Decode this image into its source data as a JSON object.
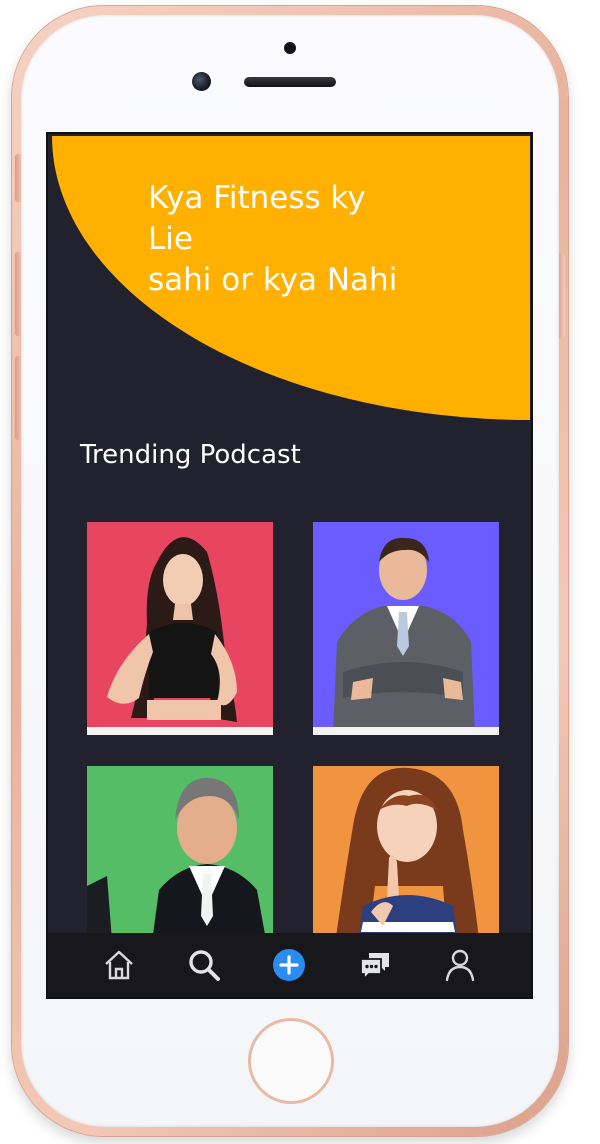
{
  "hero": {
    "title_lines": [
      "Kya Fitness ky",
      "Lie",
      "sahi or kya Nahi"
    ]
  },
  "section": {
    "title": "Trending Podcast"
  },
  "podcasts": [
    {
      "background": "#e84660",
      "icon": "woman-portrait"
    },
    {
      "background": "#6a5cff",
      "icon": "man-suit-portrait"
    },
    {
      "background": "#56bd67",
      "icon": "man-smiling-portrait"
    },
    {
      "background": "#f0943f",
      "icon": "woman-thinking-portrait"
    }
  ],
  "tabbar": [
    {
      "icon": "home-icon"
    },
    {
      "icon": "search-icon"
    },
    {
      "icon": "add-icon",
      "color": "#2a8cf0"
    },
    {
      "icon": "chat-icon"
    },
    {
      "icon": "profile-icon"
    }
  ],
  "colors": {
    "background": "#22222e",
    "accent": "#ffb000",
    "tabbar": "#17171c"
  }
}
